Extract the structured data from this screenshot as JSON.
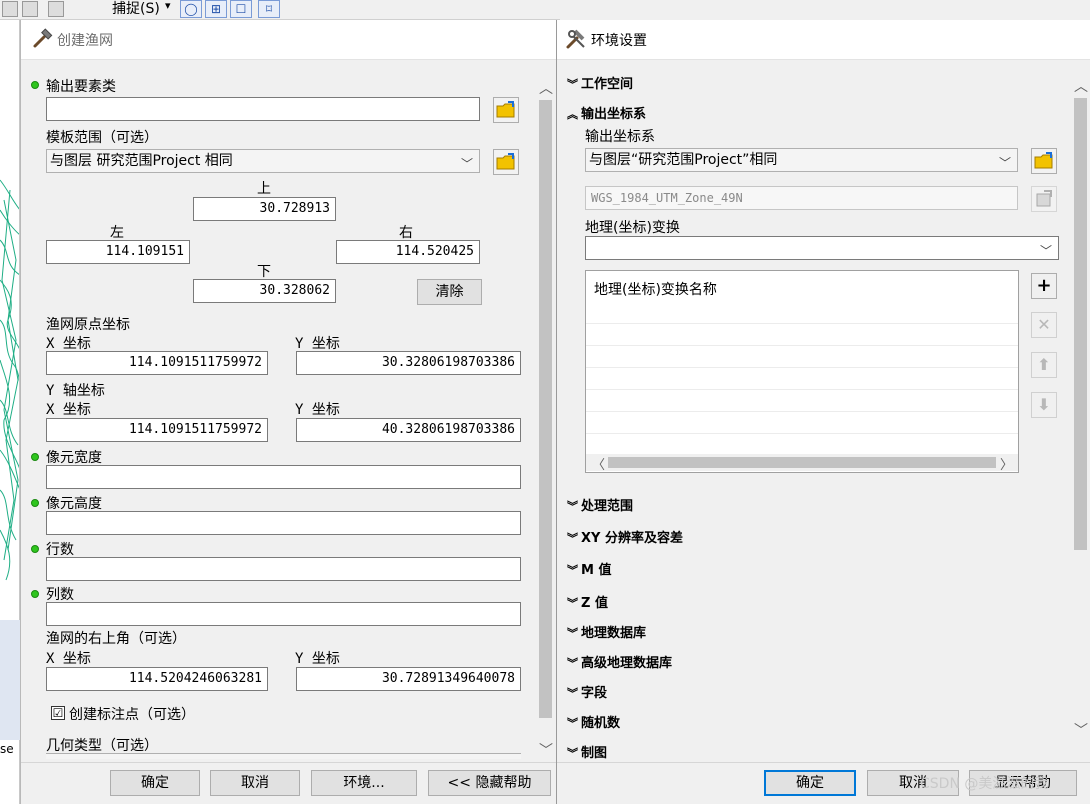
{
  "background": {
    "toolbar_snap_label": "捕捉(S)",
    "toolbar_snap_arrow": "▾",
    "toolbar_buttons": [
      "◯",
      "⊞",
      "☐",
      "⌑"
    ],
    "sidebar_text": "se"
  },
  "left_dialog": {
    "title": "创建渔网",
    "output_feature_class": {
      "label": "输出要素类",
      "value": ""
    },
    "template_extent": {
      "label": "模板范围（可选）",
      "selected": "与图层 研究范围Project 相同",
      "top_label": "上",
      "top_value": "30.728913",
      "left_label": "左",
      "left_value": "114.109151",
      "right_label": "右",
      "right_value": "114.520425",
      "bottom_label": "下",
      "bottom_value": "30.328062",
      "clear_button": "清除"
    },
    "origin": {
      "label": "渔网原点坐标",
      "x_label": "X 坐标",
      "x_value": "114.1091511759972",
      "y_label": "Y 坐标",
      "y_value": "30.32806198703386"
    },
    "y_axis": {
      "label": "Y 轴坐标",
      "x_label": "X 坐标",
      "x_value": "114.1091511759972",
      "y_label": "Y 坐标",
      "y_value": "40.32806198703386"
    },
    "cell_width": {
      "label": "像元宽度",
      "value": ""
    },
    "cell_height": {
      "label": "像元高度",
      "value": ""
    },
    "rows": {
      "label": "行数",
      "value": ""
    },
    "columns": {
      "label": "列数",
      "value": ""
    },
    "opposite_corner": {
      "label": "渔网的右上角（可选）",
      "x_label": "X 坐标",
      "x_value": "114.5204246063281",
      "y_label": "Y 坐标",
      "y_value": "30.72891349640078"
    },
    "create_label_points": {
      "label": "创建标注点（可选）",
      "checked": "☑"
    },
    "geometry_type": {
      "label": "几何类型（可选）"
    },
    "buttons": {
      "ok": "确定",
      "cancel": "取消",
      "env": "环境...",
      "hide_help": "<< 隐藏帮助"
    }
  },
  "right_dialog": {
    "title": "环境设置",
    "sections": {
      "workspace": "工作空间",
      "output_coords": "输出坐标系",
      "processing_extent": "处理范围",
      "xy_resolution": "XY 分辨率及容差",
      "m_values": "M 值",
      "z_values": "Z 值",
      "geodatabase": "地理数据库",
      "advanced_geodatabase": "高级地理数据库",
      "fields": "字段",
      "random_numbers": "随机数",
      "cartography": "制图"
    },
    "output_coords_label": "输出坐标系",
    "output_coords_selected": "与图层“研究范围Project”相同",
    "spatial_reference": "WGS_1984_UTM_Zone_49N",
    "geo_transform_label": "地理(坐标)变换",
    "geo_transform_combo": "",
    "transform_grid_header": "地理(坐标)变换名称",
    "side_buttons": {
      "add": "+",
      "remove": "✕",
      "up": "⬆",
      "down": "⬇"
    },
    "buttons": {
      "ok": "确定",
      "cancel": "取消",
      "hidden": "显示帮助"
    }
  },
  "watermark": "CSDN @美滋滋的我",
  "colors": {
    "required_dot": "#2fc51e",
    "primary_border": "#0078d7",
    "folder_yellow": "#f2c200"
  }
}
